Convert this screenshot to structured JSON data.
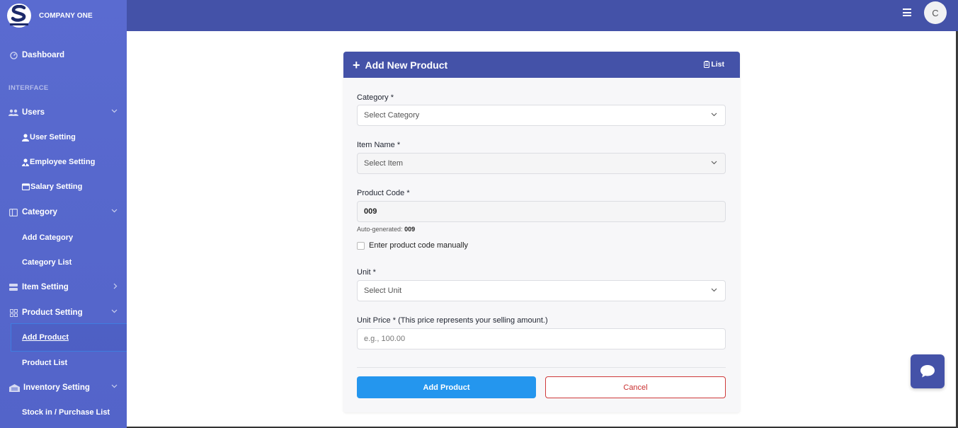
{
  "brand": {
    "name": "COMPANY ONE"
  },
  "sidebar": {
    "dashboard": "Dashboard",
    "section_label": "INTERFACE",
    "users": "Users",
    "user_setting": "User Setting",
    "employee_setting": "Employee Setting",
    "salary_setting": "Salary Setting",
    "category": "Category",
    "add_category": "Add Category",
    "category_list": "Category List",
    "item_setting": "Item Setting",
    "product_setting": "Product Setting",
    "add_product": "Add Product",
    "product_list": "Product List",
    "inventory_setting": "Inventory Setting",
    "stock_in": "Stock in / Purchase List"
  },
  "topbar": {
    "avatar_letter": "C"
  },
  "form": {
    "title": "Add New Product",
    "list_link": "List",
    "category_label": "Category *",
    "category_value": "Select Category",
    "item_label": "Item Name *",
    "item_value": "Select Item",
    "code_label": "Product Code *",
    "code_value": "009",
    "auto_prefix": "Auto-generated:",
    "auto_value": "009",
    "manual_label": "Enter product code manually",
    "unit_label": "Unit *",
    "unit_value": "Select Unit",
    "price_label": "Unit Price * (This price represents your selling amount.)",
    "price_placeholder": "e.g., 100.00",
    "submit": "Add Product",
    "cancel": "Cancel"
  },
  "colors": {
    "sidebar": "#5a6bd0",
    "header": "#4452a8",
    "primary": "#2496ee",
    "danger": "#cf3a3a"
  }
}
